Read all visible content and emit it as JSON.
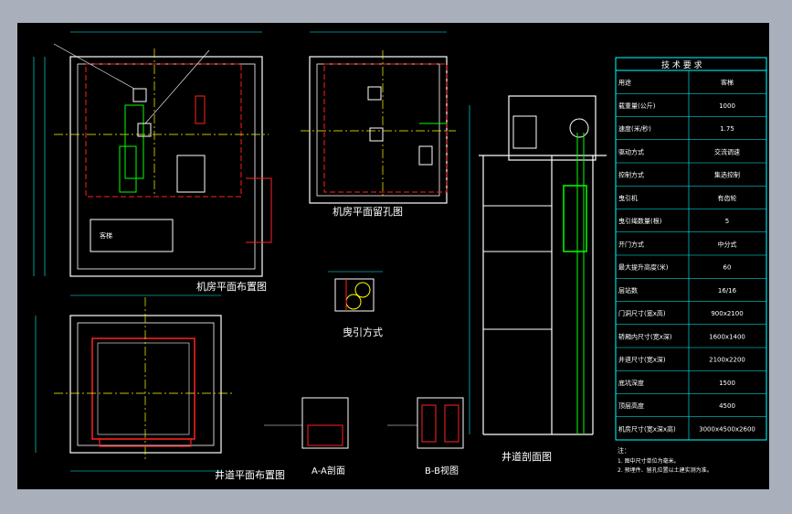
{
  "window": {
    "background": "#a9b0bb",
    "canvas_background": "#000000"
  },
  "colors": {
    "wall": "#ffffff",
    "dim": "#00ffff",
    "centerline": "#ffff00",
    "hidden": "#ff2020",
    "equipment": "#00ff00",
    "table_border": "#00ffff",
    "table_text": "#ffffff"
  },
  "drawing": {
    "titles": {
      "machine_room_layout": "机房平面布置图",
      "machine_room_holes": "机房平面留孔图",
      "hoistway_plan": "井道平面布置图",
      "hoistway_section": "井道剖面图",
      "traction_method": "曳引方式",
      "section_a": "A-A剖面",
      "view_b": "B-B视图"
    },
    "tech_table": {
      "title": "技 术 要 求",
      "rows": [
        {
          "label": "用途",
          "value": "客梯"
        },
        {
          "label": "载重量(公斤)",
          "value": "1000"
        },
        {
          "label": "速度(米/秒)",
          "value": "1.75"
        },
        {
          "label": "驱动方式",
          "value": "交流调速"
        },
        {
          "label": "控制方式",
          "value": "集选控制"
        },
        {
          "label": "曳引机",
          "value": "有齿轮"
        },
        {
          "label": "曳引绳数量(根)",
          "value": "5"
        },
        {
          "label": "开门方式",
          "value": "中分式"
        },
        {
          "label": "最大提升高度(米)",
          "value": "60"
        },
        {
          "label": "层站数",
          "value": "16/16"
        },
        {
          "label": "门洞尺寸(宽x高)",
          "value": "900x2100"
        },
        {
          "label": "轿厢内尺寸(宽x深)",
          "value": "1600x1400"
        },
        {
          "label": "井道尺寸(宽x深)",
          "value": "2100x2200"
        },
        {
          "label": "底坑深度",
          "value": "1500"
        },
        {
          "label": "顶层高度",
          "value": "4500"
        },
        {
          "label": "机房尺寸(宽x深x高)",
          "value": "3000x4500x2600"
        }
      ],
      "notes_header": "注：",
      "notes": [
        "1. 图中尺寸单位为毫米。",
        "2. 预埋件、留孔位置以土建实测为准。"
      ]
    }
  }
}
